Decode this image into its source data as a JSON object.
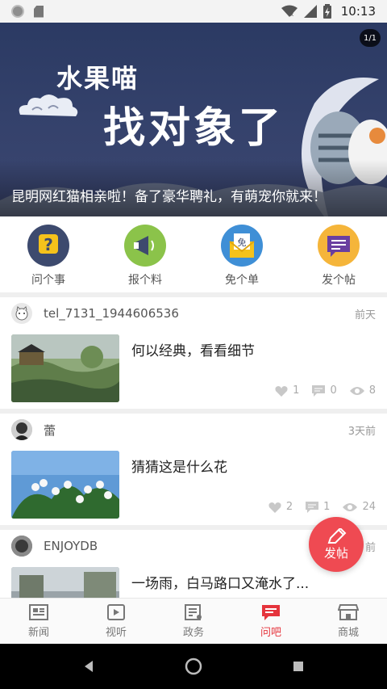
{
  "status_bar": {
    "time": "10:13"
  },
  "banner": {
    "title_line1": "水果喵",
    "title_line2": "找对象了",
    "caption": "昆明网红猫相亲啦！备了豪华聘礼，有萌宠你就来！",
    "counter": "1/1"
  },
  "quick_actions": [
    {
      "label": "问个事",
      "icon": "question-icon",
      "color": "#3d4a6e"
    },
    {
      "label": "报个料",
      "icon": "megaphone-icon",
      "color": "#8bc34a"
    },
    {
      "label": "免个单",
      "icon": "envelope-free-icon",
      "color": "#3f8fd6",
      "glyph": "免"
    },
    {
      "label": "发个帖",
      "icon": "chat-post-icon",
      "color": "#f5b53a"
    }
  ],
  "posts": [
    {
      "user": "tel_7131_1944606536",
      "time": "前天",
      "title": "何以经典，看看细节",
      "likes": "1",
      "comments": "0",
      "views": "8"
    },
    {
      "user": "蕾",
      "time": "3天前",
      "title": "猜猜这是什么花",
      "likes": "2",
      "comments": "1",
      "views": "24"
    },
    {
      "user": "ENJOYDB",
      "time": "前",
      "title": "一场雨，白马路口又淹水了..."
    }
  ],
  "fab": {
    "label": "发帖"
  },
  "tabs": [
    {
      "label": "新闻",
      "icon": "newspaper-icon",
      "active": false
    },
    {
      "label": "视听",
      "icon": "video-play-icon",
      "active": false
    },
    {
      "label": "政务",
      "icon": "government-doc-icon",
      "active": false
    },
    {
      "label": "问吧",
      "icon": "forum-chat-icon",
      "active": true
    },
    {
      "label": "商城",
      "icon": "shop-icon",
      "active": false
    }
  ],
  "colors": {
    "accent": "#e5343c",
    "fab": "#ef4a52"
  }
}
